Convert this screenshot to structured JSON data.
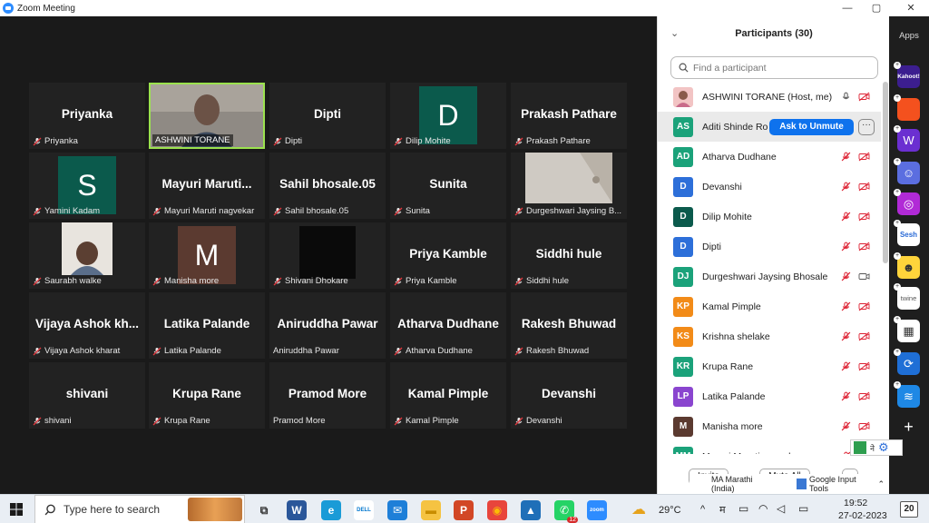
{
  "window": {
    "title": "Zoom Meeting",
    "controls": [
      "—",
      "▢",
      "✕"
    ]
  },
  "tiles": [
    {
      "big": "Priyanka",
      "label": "Priyanka",
      "kind": "name"
    },
    {
      "big": "",
      "label": "ASHWINI TORANE",
      "kind": "video-active"
    },
    {
      "big": "Dipti",
      "label": "Dipti",
      "kind": "name"
    },
    {
      "big": "D",
      "label": "Dilip Mohite",
      "kind": "avatar",
      "color": "#0b5a4c"
    },
    {
      "big": "Prakash Pathare",
      "label": "Prakash Pathare",
      "kind": "name"
    },
    {
      "big": "S",
      "label": "Yamini Kadam",
      "kind": "avatar",
      "color": "#0b5a4c"
    },
    {
      "big": "Mayuri Maruti...",
      "label": "Mayuri Maruti nagvekar",
      "kind": "name"
    },
    {
      "big": "Sahil bhosale.05",
      "label": "Sahil bhosale.05",
      "kind": "name"
    },
    {
      "big": "Sunita",
      "label": "Sunita",
      "kind": "name"
    },
    {
      "big": "",
      "label": "Durgeshwari Jaysing B...",
      "kind": "video-wall"
    },
    {
      "big": "",
      "label": "Saurabh walke",
      "kind": "video-person"
    },
    {
      "big": "M",
      "label": "Manisha more",
      "kind": "avatar",
      "color": "#5b3a30"
    },
    {
      "big": "",
      "label": "Shivani Dhokare",
      "kind": "video-black"
    },
    {
      "big": "Priya Kamble",
      "label": "Priya Kamble",
      "kind": "name"
    },
    {
      "big": "Siddhi hule",
      "label": "Siddhi hule",
      "kind": "name"
    },
    {
      "big": "Vijaya Ashok kh...",
      "label": "Vijaya Ashok kharat",
      "kind": "name"
    },
    {
      "big": "Latika Palande",
      "label": "Latika Palande",
      "kind": "name"
    },
    {
      "big": "Aniruddha Pawar",
      "label": "Aniruddha Pawar",
      "kind": "name-nomic"
    },
    {
      "big": "Atharva Dudhane",
      "label": "Atharva Dudhane",
      "kind": "name"
    },
    {
      "big": "Rakesh Bhuwad",
      "label": "Rakesh Bhuwad",
      "kind": "name"
    },
    {
      "big": "shivani",
      "label": "shivani",
      "kind": "name"
    },
    {
      "big": "Krupa Rane",
      "label": "Krupa Rane",
      "kind": "name"
    },
    {
      "big": "Pramod More",
      "label": "Pramod More",
      "kind": "name-nomic"
    },
    {
      "big": "Kamal Pimple",
      "label": "Kamal Pimple",
      "kind": "name"
    },
    {
      "big": "Devanshi",
      "label": "Devanshi",
      "kind": "name"
    }
  ],
  "participants_panel": {
    "title": "Participants (30)",
    "search_placeholder": "Find a participant",
    "ask_unmute": "Ask to Unmute",
    "more": "···",
    "rows": [
      {
        "initials": "",
        "name": "ASHWINI TORANE (Host, me)",
        "color": "#f2c4c4",
        "photo": true,
        "icons": "host"
      },
      {
        "initials": "AS",
        "name": "Aditi Shinde Ro",
        "color": "#1ba27a",
        "icons": "hover"
      },
      {
        "initials": "AD",
        "name": "Atharva Dudhane",
        "color": "#1ba27a",
        "icons": "muted"
      },
      {
        "initials": "D",
        "name": "Devanshi",
        "color": "#2d6fd9",
        "icons": "muted"
      },
      {
        "initials": "D",
        "name": "Dilip Mohite",
        "color": "#0b5a4c",
        "icons": "muted"
      },
      {
        "initials": "D",
        "name": "Dipti",
        "color": "#2d6fd9",
        "icons": "muted"
      },
      {
        "initials": "DJ",
        "name": "Durgeshwari Jaysing Bhosale",
        "color": "#1ba27a",
        "icons": "video"
      },
      {
        "initials": "KP",
        "name": "Kamal Pimple",
        "color": "#f28b18",
        "icons": "muted"
      },
      {
        "initials": "KS",
        "name": "Krishna shelake",
        "color": "#f28b18",
        "icons": "muted"
      },
      {
        "initials": "KR",
        "name": "Krupa Rane",
        "color": "#1ba27a",
        "icons": "muted"
      },
      {
        "initials": "LP",
        "name": "Latika Palande",
        "color": "#8a45cf",
        "icons": "muted"
      },
      {
        "initials": "M",
        "name": "Manisha more",
        "color": "#5b3a30",
        "icons": "muted"
      },
      {
        "initials": "MM",
        "name": "Mayuri Maruti nagvekar",
        "color": "#1ba27a",
        "icons": "muted"
      }
    ],
    "invite": "Invite",
    "mute_all": "Mute All",
    "dots": "···"
  },
  "apps_sidebar": {
    "label": "Apps",
    "icons": [
      "kahoot-icon",
      "caption-icon",
      "wooclap-icon",
      "smile-icon",
      "radio-icon",
      "sesh-icon",
      "emoji-icon",
      "twine-icon",
      "grid-app-icon",
      "sync-icon",
      "stack-icon",
      "add-icon"
    ],
    "sesh": "Sesh",
    "twine": "twine",
    "kahoot": "Kahoot!"
  },
  "ime_bar": {
    "language": "MA Marathi (India)",
    "tool": "Google Input Tools",
    "script_char": "ने"
  },
  "taskbar": {
    "search_placeholder": "Type here to search",
    "weather": "29°C",
    "ime_char": "म",
    "time": "19:52",
    "date": "27-02-2023",
    "notification_count": "20",
    "whatsapp_badge": "12"
  }
}
